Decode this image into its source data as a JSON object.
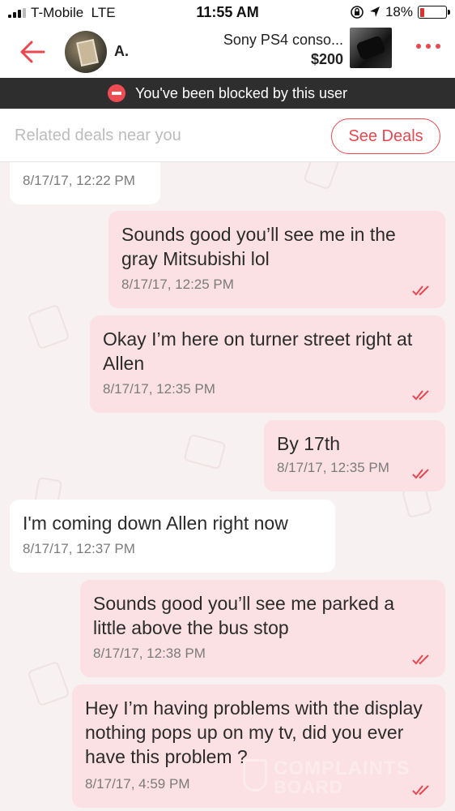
{
  "status_bar": {
    "carrier": "T-Mobile",
    "network": "LTE",
    "time": "11:55 AM",
    "battery": "18%",
    "battery_level": 0.18
  },
  "header": {
    "user_name": "A.",
    "listing_title": "Sony PS4 conso...",
    "listing_price": "$200"
  },
  "blocked_banner": {
    "text": "You've been blocked by this user"
  },
  "deals_bar": {
    "label": "Related deals near you",
    "button": "See Deals"
  },
  "messages": [
    {
      "direction": "in",
      "text": "",
      "time": "8/17/17, 12:22 PM"
    },
    {
      "direction": "out",
      "text": "Sounds good you’ll see me in the gray Mitsubishi lol",
      "time": "8/17/17, 12:25 PM"
    },
    {
      "direction": "out",
      "text": "Okay I’m here on turner street right at Allen",
      "time": "8/17/17, 12:35 PM"
    },
    {
      "direction": "out",
      "text": "By 17th",
      "time": "8/17/17, 12:35 PM"
    },
    {
      "direction": "in",
      "text": "I'm coming down Allen right now",
      "time": "8/17/17, 12:37 PM"
    },
    {
      "direction": "out",
      "text": "Sounds good you’ll see me parked a little above the bus stop",
      "time": "8/17/17, 12:38 PM"
    },
    {
      "direction": "out",
      "text": "Hey I’m having problems with the display nothing pops up on my tv, did you ever have this problem ?",
      "time": "8/17/17, 4:59 PM"
    }
  ],
  "watermark": {
    "line1": "COMPLAINTS",
    "line2": "BOARD"
  },
  "colors": {
    "accent": "#e8474f",
    "outgoing_bubble": "#fbe1e4",
    "incoming_bubble": "#ffffff",
    "banner": "#2e2e2e"
  },
  "icons": {
    "back": "back-arrow-icon",
    "more": "more-dots-icon",
    "blocked": "blocked-icon",
    "read": "double-check-icon"
  }
}
